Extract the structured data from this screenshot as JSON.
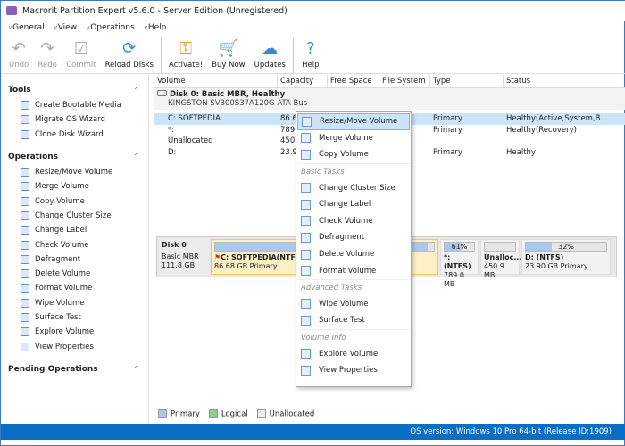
{
  "window": {
    "title": "Macrorit Partition Expert v5.6.0 - Server Edition (Unregistered)"
  },
  "menu": [
    "General",
    "View",
    "Operations",
    "Help"
  ],
  "toolbar": [
    {
      "label": "Undo",
      "icon": "undo-icon",
      "disabled": true,
      "glyph": "↶"
    },
    {
      "label": "Redo",
      "icon": "redo-icon",
      "disabled": true,
      "glyph": "↷"
    },
    {
      "label": "Commit",
      "icon": "commit-icon",
      "disabled": true,
      "glyph": "☑"
    },
    {
      "label": "Reload Disks",
      "icon": "reload-icon",
      "glyph": "⟳"
    },
    {
      "sep": true
    },
    {
      "label": "Activate!",
      "icon": "key-icon",
      "glyph": "⚿"
    },
    {
      "label": "Buy Now",
      "icon": "cart-icon",
      "glyph": "🛒"
    },
    {
      "label": "Updates",
      "icon": "cloud-upload-icon",
      "glyph": "☁"
    },
    {
      "sep": true
    },
    {
      "label": "Help",
      "icon": "help-icon",
      "glyph": "?"
    }
  ],
  "sidebar": {
    "tools": {
      "title": "Tools",
      "items": [
        "Create Bootable Media",
        "Migrate OS Wizard",
        "Clone Disk Wizard"
      ]
    },
    "operations": {
      "title": "Operations",
      "items": [
        "Resize/Move Volume",
        "Merge Volume",
        "Copy Volume",
        "Change Cluster Size",
        "Change Label",
        "Check Volume",
        "Defragment",
        "Delete Volume",
        "Format Volume",
        "Wipe Volume",
        "Surface Test",
        "Explore Volume",
        "View Properties"
      ]
    },
    "pending": {
      "title": "Pending Operations"
    }
  },
  "table": {
    "columns": [
      "Volume",
      "Capacity",
      "Free Space",
      "File System",
      "Type",
      "Status"
    ],
    "disk": {
      "title": "Disk 0: Basic MBR, Healthy",
      "model": "KINGSTON SV300S37A120G ATA Bus"
    },
    "rows": [
      [
        "C: SOFTPEDIA",
        "86.6",
        "",
        "",
        "Primary",
        "Healthy(Active,System,B..."
      ],
      [
        "*:",
        "789.",
        "",
        "",
        "Primary",
        "Healthy(Recovery)"
      ],
      [
        "Unallocated",
        "450.",
        "",
        "",
        "",
        ""
      ],
      [
        "D:",
        "23.9",
        "",
        "",
        "Primary",
        "Healthy"
      ]
    ]
  },
  "diskmap": {
    "disk": {
      "name": "Disk 0",
      "type": "Basic MBR",
      "size": "111.8 GB"
    },
    "parts": [
      {
        "name": "C: SOFTPEDIA(NTFS)",
        "info": "86.68 GB Primary",
        "used": 97
      },
      {
        "name": "*: (NTFS)",
        "info": "789.0 MB",
        "used": 61,
        "pct": "61%"
      },
      {
        "name": "Unalloc...",
        "info": "450.9 MB",
        "used": 0
      },
      {
        "name": "D: (NTFS)",
        "info": "23.90 GB Primary",
        "used": 32,
        "pct": "32%"
      }
    ]
  },
  "context_menu": [
    {
      "label": "Resize/Move Volume",
      "hl": true
    },
    {
      "label": "Merge Volume"
    },
    {
      "label": "Copy Volume"
    },
    {
      "header": "Basic Tasks"
    },
    {
      "label": "Change Cluster Size"
    },
    {
      "label": "Change Label"
    },
    {
      "label": "Check Volume"
    },
    {
      "label": "Defragment"
    },
    {
      "label": "Delete Volume"
    },
    {
      "label": "Format Volume"
    },
    {
      "header": "Advanced Tasks"
    },
    {
      "label": "Wipe Volume"
    },
    {
      "label": "Surface Test"
    },
    {
      "header": "Volume Info"
    },
    {
      "label": "Explore Volume"
    },
    {
      "label": "View Properties"
    }
  ],
  "legend": [
    "Primary",
    "Logical",
    "Unallocated"
  ],
  "status": "OS version: Windows 10 Pro  64-bit  (Release ID:1909)"
}
